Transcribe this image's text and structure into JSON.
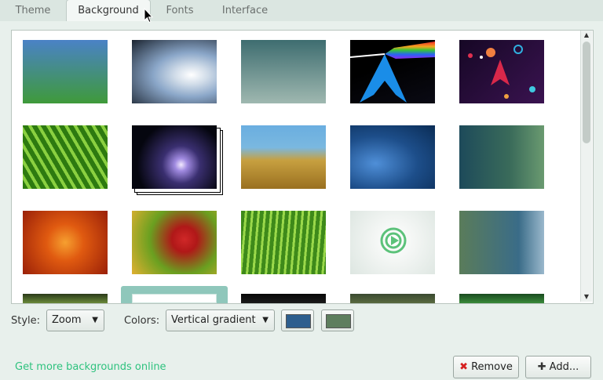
{
  "tabs": [
    {
      "label": "Theme"
    },
    {
      "label": "Background"
    },
    {
      "label": "Fonts"
    },
    {
      "label": "Interface"
    }
  ],
  "active_tab": "Background",
  "gallery": {
    "rows": [
      [
        {
          "name": "green-blue-gradient",
          "colors": [
            "#4a82c6",
            "#3f9a3a"
          ]
        },
        {
          "name": "water-drop",
          "colors": [
            "#1b2430",
            "#cfdbe8"
          ]
        },
        {
          "name": "teal-blur",
          "colors": [
            "#3e6d70",
            "#9fb8b0"
          ]
        },
        {
          "name": "arch-prism",
          "colors": [
            "#000000",
            "#3b8de0"
          ]
        },
        {
          "name": "purple-space-rocket",
          "colors": [
            "#1e0b30",
            "#3a1350"
          ]
        }
      ],
      [
        {
          "name": "green-leaf",
          "colors": [
            "#2d7a10",
            "#9ad94a"
          ]
        },
        {
          "name": "comet",
          "colors": [
            "#05060f",
            "#6b5aa8"
          ]
        },
        {
          "name": "beach-grass",
          "colors": [
            "#5aa2d9",
            "#c89a32"
          ]
        },
        {
          "name": "blue-drops",
          "colors": [
            "#0a2c55",
            "#3a7cc0"
          ]
        },
        {
          "name": "teal-bokeh",
          "colors": [
            "#1d4a5a",
            "#4f8a70"
          ]
        }
      ],
      [
        {
          "name": "orange-flower",
          "colors": [
            "#b83008",
            "#f09020"
          ]
        },
        {
          "name": "red-flower",
          "colors": [
            "#6aa020",
            "#c8202a"
          ]
        },
        {
          "name": "grass-blades",
          "colors": [
            "#3e8a1a",
            "#9ad84a"
          ]
        },
        {
          "name": "white-logo",
          "colors": [
            "#f2f5f3",
            "#dde6e1"
          ]
        },
        {
          "name": "green-blue-fade",
          "colors": [
            "#4e7a50",
            "#2f6890"
          ]
        }
      ],
      [
        {
          "name": "partial-1",
          "colors": [
            "#2a3a1a",
            "#6a8a3a"
          ]
        },
        {
          "name": "partial-selected",
          "colors": [
            "#ffffff",
            "#ffffff"
          ]
        },
        {
          "name": "partial-3",
          "colors": [
            "#080808",
            "#1a1a1a"
          ]
        },
        {
          "name": "partial-4",
          "colors": [
            "#3a4a30",
            "#5a6a40"
          ]
        },
        {
          "name": "partial-5",
          "colors": [
            "#1a4a20",
            "#3a8a3a"
          ]
        }
      ]
    ]
  },
  "controls": {
    "style_label": "Style:",
    "style_value": "Zoom",
    "colors_label": "Colors:",
    "colors_value": "Vertical gradient",
    "color1": "#2e5e8e",
    "color2": "#5e7e5e"
  },
  "footer": {
    "link_text": "Get more backgrounds online",
    "remove_label": "Remove",
    "add_label": "Add..."
  },
  "accent": "#2ec27e"
}
